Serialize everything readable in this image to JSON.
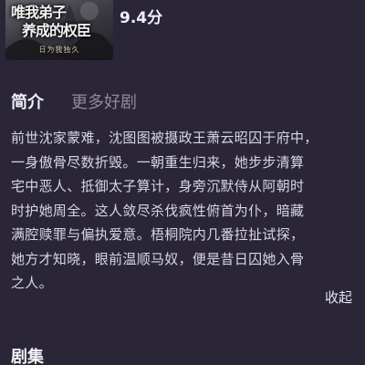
{
  "poster": {
    "title_line1": "唯我弟子",
    "title_line2": "养成的权臣",
    "subtitle": "日为我独久"
  },
  "rating": "9.4分",
  "tabs": [
    {
      "label": "简介",
      "active": true
    },
    {
      "label": "更多好剧",
      "active": false
    }
  ],
  "synopsis": {
    "lines": [
      "前世沈家蒙难，沈图图被摄政王萧云昭囚于府中，",
      "一身傲骨尽数折毁。一朝重生归来，她步步清算",
      "宅中恶人、抵御太子算计，身旁沉默侍从阿朝时",
      "时护她周全。这人敛尽杀伐疯性俯首为仆，暗藏",
      "满腔赎罪与偏执爱意。梧桐院内几番拉扯试探，",
      "她方才知晓，眼前温顺马奴，便是昔日囚她入骨",
      "之人。"
    ]
  },
  "collapse_label": "收起",
  "episodes_section_title": "剧集"
}
